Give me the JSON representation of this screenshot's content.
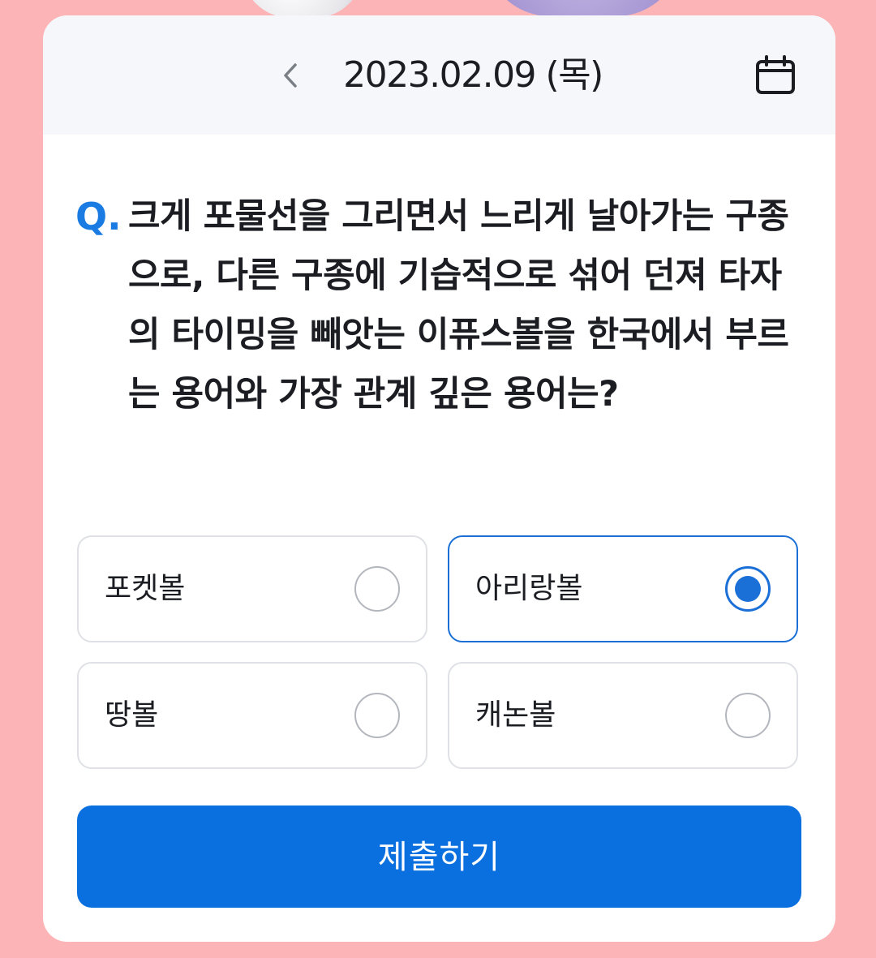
{
  "header": {
    "date": "2023.02.09 (목)",
    "prev_icon": "chevron-left-icon",
    "calendar_icon": "calendar-icon"
  },
  "question": {
    "prefix": "Q.",
    "text": "크게 포물선을 그리면서 느리게 날아가는 구종으로, 다른 구종에 기습적으로 섞어 던져 타자의 타이밍을 빼앗는 이퓨스볼을 한국에서 부르는 용어와 가장 관계 깊은 용어는?"
  },
  "options": [
    {
      "label": "포켓볼",
      "selected": false
    },
    {
      "label": "아리랑볼",
      "selected": true
    },
    {
      "label": "땅볼",
      "selected": false
    },
    {
      "label": "캐논볼",
      "selected": false
    }
  ],
  "submit_label": "제출하기",
  "colors": {
    "accent": "#0a6fdf",
    "background": "#fcb4b6",
    "header_bg": "#f6f7fb"
  }
}
